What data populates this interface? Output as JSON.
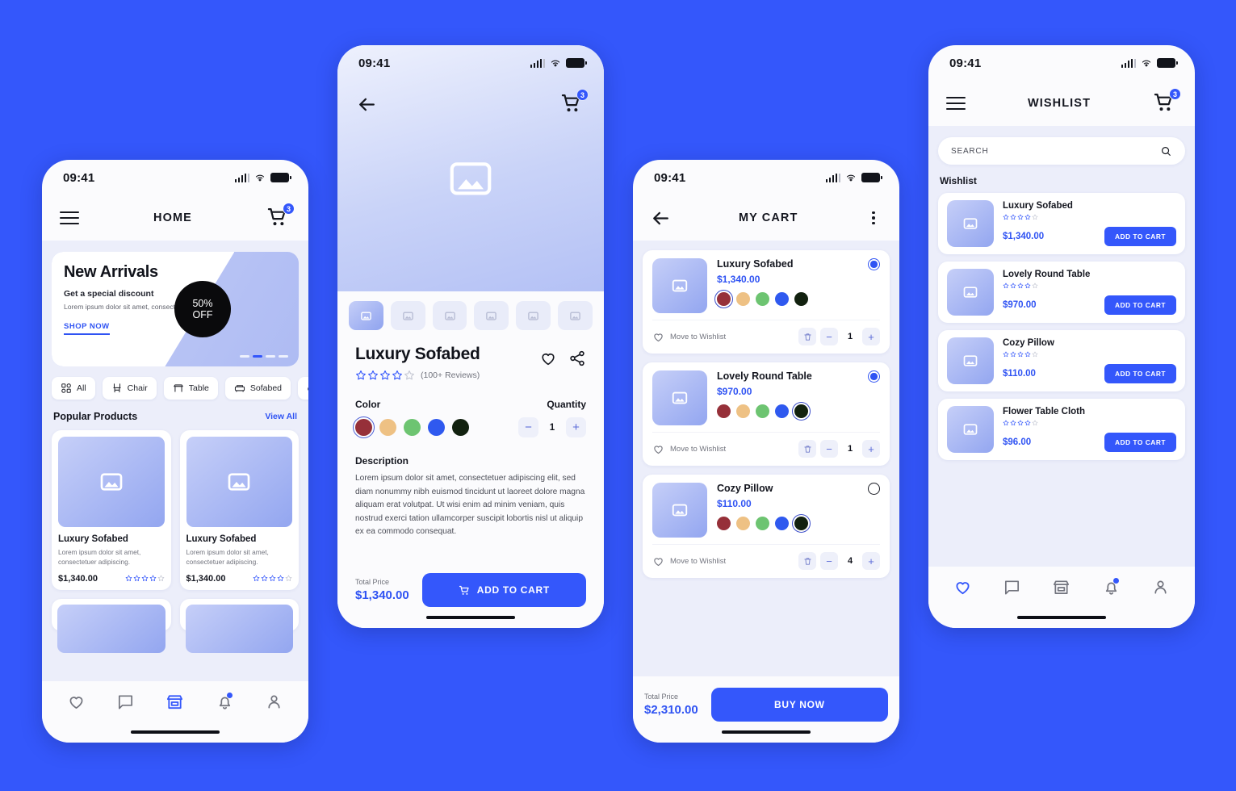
{
  "theme": {
    "background": "#3457fb",
    "accent": "#3457fb",
    "accent_text": "#2f53f3",
    "screen_bg": "#eceefa",
    "card": "#ffffff"
  },
  "status_bar": {
    "time": "09:41"
  },
  "swatch_colors": [
    "#963039",
    "#eec184",
    "#6dc471",
    "#2f59ef",
    "#12210f"
  ],
  "home": {
    "appbar": {
      "title": "HOME",
      "cart_badge": "3"
    },
    "hero": {
      "title": "New Arrivals",
      "subtitle": "Get a special discount",
      "paragraph": "Lorem ipsum dolor sit amet, consectetuer adipiscing.",
      "cta": "SHOP NOW",
      "badge_line1": "50%",
      "badge_line2": "OFF",
      "dots_count": 4,
      "dots_active_index": 1
    },
    "chips": [
      {
        "label": "All",
        "icon": "grid-icon"
      },
      {
        "label": "Chair",
        "icon": "chair-icon"
      },
      {
        "label": "Table",
        "icon": "table-icon"
      },
      {
        "label": "Sofabed",
        "icon": "sofabed-icon"
      },
      {
        "label": "",
        "icon": "armchair-icon"
      }
    ],
    "section": {
      "title": "Popular Products",
      "link": "View All"
    },
    "products": [
      {
        "name": "Luxury Sofabed",
        "desc": "Lorem ipsum dolor sit amet, consectetuer adipiscing.",
        "price": "$1,340.00",
        "rating": 4
      },
      {
        "name": "Luxury Sofabed",
        "desc": "Lorem ipsum dolor sit amet, consectetuer adipiscing.",
        "price": "$1,340.00",
        "rating": 4
      }
    ],
    "bottom_nav": [
      {
        "icon": "heart-icon",
        "active": false
      },
      {
        "icon": "chat-icon",
        "active": false
      },
      {
        "icon": "store-icon",
        "active": true
      },
      {
        "icon": "bell-icon",
        "active": false,
        "dot": true
      },
      {
        "icon": "person-icon",
        "active": false
      }
    ]
  },
  "product_detail": {
    "appbar": {
      "cart_badge": "3"
    },
    "thumbs_count": 6,
    "thumbs_active_index": 0,
    "title": "Luxury Sofabed",
    "rating": 4,
    "reviews": "(100+ Reviews)",
    "color_label": "Color",
    "quantity_label": "Quantity",
    "selected_color_index": 0,
    "quantity": "1",
    "description_label": "Description",
    "description": "Lorem ipsum dolor sit amet, consectetuer adipiscing elit, sed diam nonummy nibh euismod tincidunt ut laoreet dolore magna aliquam erat volutpat. Ut wisi enim ad minim veniam, quis nostrud exerci tation ullamcorper suscipit lobortis nisl ut aliquip ex ea commodo consequat.",
    "total_price_label": "Total Price",
    "total_price": "$1,340.00",
    "cta": "ADD TO CART"
  },
  "cart": {
    "appbar": {
      "title": "MY CART"
    },
    "items": [
      {
        "name": "Luxury Sofabed",
        "price": "$1,340.00",
        "selected_color_index": 0,
        "qty": "1",
        "selected": true,
        "wishlist_label": "Move to Wishlist"
      },
      {
        "name": "Lovely Round Table",
        "price": "$970.00",
        "selected_color_index": 4,
        "qty": "1",
        "selected": true,
        "wishlist_label": "Move to Wishlist"
      },
      {
        "name": "Cozy Pillow",
        "price": "$110.00",
        "selected_color_index": 4,
        "qty": "4",
        "selected": false,
        "wishlist_label": "Move to Wishlist"
      }
    ],
    "total_price_label": "Total Price",
    "total_price": "$2,310.00",
    "cta": "BUY NOW"
  },
  "wishlist": {
    "appbar": {
      "title": "WISHLIST",
      "cart_badge": "3"
    },
    "search": {
      "value": "",
      "placeholder": "SEARCH"
    },
    "section_title": "Wishlist",
    "items": [
      {
        "name": "Luxury Sofabed",
        "price": "$1,340.00",
        "rating": 4,
        "button": "ADD TO CART"
      },
      {
        "name": "Lovely Round Table",
        "price": "$970.00",
        "rating": 4,
        "button": "ADD TO CART"
      },
      {
        "name": "Cozy Pillow",
        "price": "$110.00",
        "rating": 4,
        "button": "ADD TO CART"
      },
      {
        "name": "Flower Table Cloth",
        "price": "$96.00",
        "rating": 4,
        "button": "ADD TO CART"
      }
    ],
    "bottom_nav": [
      {
        "icon": "heart-icon",
        "active": true
      },
      {
        "icon": "chat-icon",
        "active": false
      },
      {
        "icon": "store-icon",
        "active": false
      },
      {
        "icon": "bell-icon",
        "active": false,
        "dot": true
      },
      {
        "icon": "person-icon",
        "active": false
      }
    ]
  }
}
